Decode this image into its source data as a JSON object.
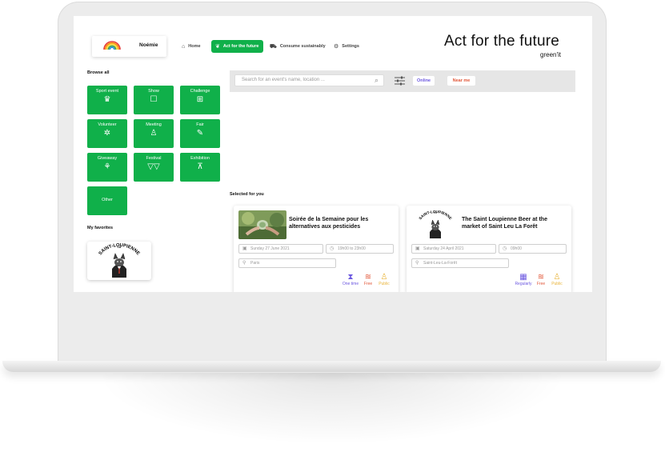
{
  "header": {
    "user_name": "Noémie",
    "nav": [
      {
        "label": "Home",
        "icon": "home-icon",
        "active": false
      },
      {
        "label": "Act for the future",
        "icon": "hands-icon",
        "active": true
      },
      {
        "label": "Consume sustainably",
        "icon": "cart-icon",
        "active": false
      },
      {
        "label": "Settings",
        "icon": "gear-icon",
        "active": false
      }
    ],
    "brand_title": "Act for the future",
    "brand_sub": "green'it"
  },
  "browse": {
    "title": "Browse all",
    "categories": [
      {
        "label": "Sport event",
        "icon": "trophy-icon"
      },
      {
        "label": "Show",
        "icon": "popcorn-icon"
      },
      {
        "label": "Challenge",
        "icon": "puzzle-icon"
      },
      {
        "label": "Volunteer",
        "icon": "heart-hands-icon"
      },
      {
        "label": "Meeting",
        "icon": "person-icon"
      },
      {
        "label": "Fair",
        "icon": "feather-icon"
      },
      {
        "label": "Giveaway",
        "icon": "gift-icon"
      },
      {
        "label": "Festival",
        "icon": "bunting-icon"
      },
      {
        "label": "Exhibition",
        "icon": "easel-icon"
      },
      {
        "label": "Other",
        "icon": ""
      }
    ]
  },
  "favorites": {
    "title": "My favorites",
    "logo_text": "SAINT-LOUPIENNE",
    "logo_small": "LA"
  },
  "search": {
    "placeholder": "Search for an event's name, location ...",
    "online_label": "Online",
    "near_label": "Near me"
  },
  "selected": {
    "title": "Selected for you",
    "cards": [
      {
        "title": "Soirée de la Semaine pour les alternatives aux pesticides",
        "date": "Sunday 27 June 2021",
        "time": "19h00 to 23h00",
        "location": "Paris",
        "attrs": [
          {
            "label": "One time",
            "color": "#6b57e0",
            "icon": "hourglass-icon"
          },
          {
            "label": "Free",
            "color": "#e2583a",
            "icon": "free-icon"
          },
          {
            "label": "Public",
            "color": "#e9b43a",
            "icon": "public-icon"
          }
        ]
      },
      {
        "title": "The Saint Loupienne Beer at the market of Saint Leu La Forêt",
        "date": "Saturday 24 April 2021",
        "time": "09h00",
        "location": "Saint-Leu-La-Forêt",
        "attrs": [
          {
            "label": "Regularly",
            "color": "#6b57e0",
            "icon": "calendar-icon"
          },
          {
            "label": "Free",
            "color": "#e2583a",
            "icon": "free-icon"
          },
          {
            "label": "Public",
            "color": "#e9b43a",
            "icon": "public-icon"
          }
        ]
      }
    ]
  },
  "colors": {
    "accent_green": "#10b04a",
    "online": "#6b57e0",
    "near_me": "#e2583a"
  }
}
